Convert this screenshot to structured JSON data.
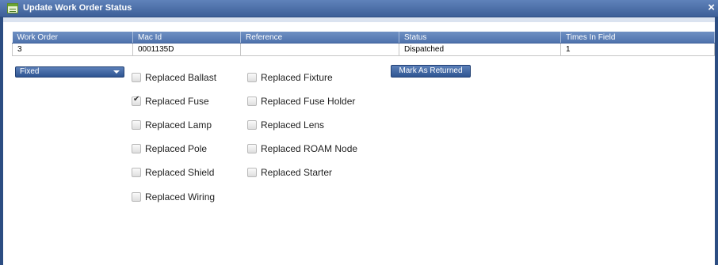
{
  "window": {
    "title": "Update Work Order Status",
    "close_symbol": "×"
  },
  "grid": {
    "columns": [
      "Work Order",
      "Mac Id",
      "Reference",
      "Status",
      "Times In Field"
    ],
    "rows": [
      [
        "3",
        "0001135D",
        "",
        "Dispatched",
        "1"
      ]
    ]
  },
  "status_select": {
    "value": "Fixed"
  },
  "checkboxes": {
    "col1": [
      {
        "label": "Replaced Ballast",
        "checked": false
      },
      {
        "label": "Replaced Fuse",
        "checked": true
      },
      {
        "label": "Replaced Lamp",
        "checked": false
      },
      {
        "label": "Replaced Pole",
        "checked": false
      },
      {
        "label": "Replaced Shield",
        "checked": false
      },
      {
        "label": "Replaced Wiring",
        "checked": false
      }
    ],
    "col2": [
      {
        "label": "Replaced Fixture",
        "checked": false
      },
      {
        "label": "Replaced Fuse Holder",
        "checked": false
      },
      {
        "label": "Replaced Lens",
        "checked": false
      },
      {
        "label": "Replaced ROAM Node",
        "checked": false
      },
      {
        "label": "Replaced Starter",
        "checked": false
      }
    ]
  },
  "mark_button": {
    "label": "Mark As Returned"
  },
  "colors": {
    "titlebar": "#3d5f98",
    "header": "#4f73ad",
    "border": "#2c4d82"
  },
  "icons": {
    "title": "window-form-icon",
    "close": "close-icon",
    "select_caret": "chevron-down-icon"
  }
}
